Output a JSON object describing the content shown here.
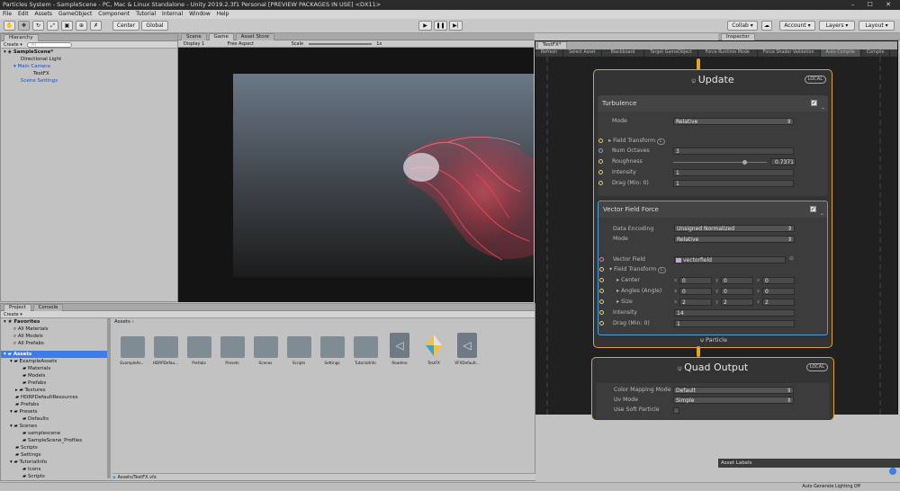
{
  "window": {
    "title": "Particles System - SampleScene - PC, Mac & Linux Standalone - Unity 2019.2.3f1 Personal [PREVIEW PACKAGES IN USE] <DX11>"
  },
  "menu": [
    "File",
    "Edit",
    "Assets",
    "GameObject",
    "Component",
    "Tutorial",
    "Internal",
    "Window",
    "Help"
  ],
  "toolbar": {
    "center_label": "Center",
    "global_label": "Global",
    "collab_label": "Collab",
    "account_label": "Account",
    "layers_label": "Layers",
    "layout_label": "Layout"
  },
  "hierarchy": {
    "tab": "Hierarchy",
    "create_label": "Create",
    "search_placeholder": "All",
    "items": [
      {
        "label": "SampleScene*"
      },
      {
        "label": "Directional Light"
      },
      {
        "label": "Main Camera"
      },
      {
        "label": "TestFX"
      },
      {
        "label": "Scene Settings"
      }
    ]
  },
  "scene_tabs": {
    "scene": "Scene",
    "game": "Game",
    "asset_store": "Asset Store"
  },
  "game_bar": {
    "display": "Display 1",
    "aspect": "Free Aspect",
    "scale_label": "Scale",
    "scale_value": "1x"
  },
  "inspector": {
    "tab": "Inspector",
    "asset_labels": "Asset Labels"
  },
  "vfx": {
    "tab": "TestFX*",
    "toolbar": [
      "Refresh",
      "Select Asset",
      "Blackboard",
      "Target GameObject",
      "Force Runtime Mode",
      "Force Shader Validation",
      "Auto Compile",
      "Compile"
    ],
    "update": {
      "title": "Update",
      "badge": "LOCAL",
      "turbulence": {
        "title": "Turbulence",
        "mode_label": "Mode",
        "mode_value": "Relative",
        "field_transform": "Field Transform",
        "field_transform_badge": "L",
        "num_octaves_label": "Num Octaves",
        "num_octaves": "3",
        "roughness_label": "Roughness",
        "roughness": "0.7371",
        "roughness_fraction": 0.737,
        "intensity_label": "Intensity",
        "intensity": "1",
        "drag_label": "Drag (Min: 0)",
        "drag": "1"
      },
      "vector_field": {
        "title": "Vector Field Force",
        "encoding_label": "Data Encoding",
        "encoding_value": "Unsigned Normalized",
        "mode_label": "Mode",
        "mode_value": "Relative",
        "vector_field_label": "Vector Field",
        "vector_field_value": "vectorfield",
        "field_transform": "Field Transform",
        "field_transform_badge": "L",
        "center_label": "Center",
        "center": [
          "0",
          "0",
          "0"
        ],
        "angles_label": "Angles (Angle)",
        "angles": [
          "0",
          "0",
          "0"
        ],
        "size_label": "Size",
        "size": [
          "2",
          "2",
          "2"
        ],
        "intensity_label": "Intensity",
        "intensity": "14",
        "drag_label": "Drag (Min: 0)",
        "drag": "1"
      },
      "footer": "Particle"
    },
    "output": {
      "title": "Quad Output",
      "badge": "LOCAL",
      "color_mapping_label": "Color Mapping Mode",
      "color_mapping": "Default",
      "uv_mode_label": "Uv Mode",
      "uv_mode": "Simple",
      "soft_particle_label": "Use Soft Particle"
    },
    "axes": [
      "x",
      "y",
      "z"
    ]
  },
  "project": {
    "tab": "Project",
    "console_tab": "Console",
    "create_label": "Create",
    "favorites": [
      "Favorites",
      "All Materials",
      "All Models",
      "All Prefabs"
    ],
    "tree": [
      "Assets",
      "ExampleAssets",
      "Materials",
      "Models",
      "Prefabs",
      "Textures",
      "HDRPDefaultResources",
      "Prefabs",
      "Presets",
      "Defaults",
      "Scenes",
      "samplescene",
      "SampleScene_Profiles",
      "Scripts",
      "Settings",
      "TutorialInfo",
      "Icons",
      "Scripts"
    ],
    "breadcrumb": "Assets",
    "assets": [
      "ExampleAs...",
      "HDRPDefau...",
      "Prefabs",
      "Presets",
      "Scenes",
      "Scripts",
      "Settings",
      "TutorialInfo",
      "Readme",
      "TestFX",
      "VFXDefault..."
    ],
    "path": "Assets/TestFX.vfx"
  },
  "status": {
    "right": "Auto Generate Lighting Off"
  },
  "colors": {
    "accent": "#e0a526",
    "selection": "#4aa3df",
    "particles": "#e23b4a"
  }
}
